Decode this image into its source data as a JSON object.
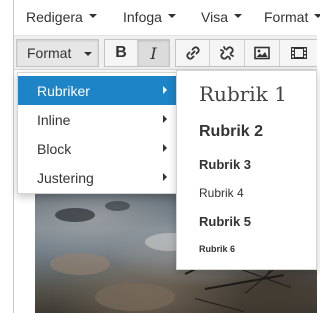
{
  "menubar": {
    "items": [
      {
        "label": "Redigera"
      },
      {
        "label": "Infoga"
      },
      {
        "label": "Visa"
      },
      {
        "label": "Format"
      }
    ]
  },
  "toolbar": {
    "format_label": "Format",
    "bold_label": "B",
    "italic_label": "I",
    "icons": [
      "link-icon",
      "unlink-icon",
      "image-icon",
      "media-icon"
    ]
  },
  "format_menu": {
    "items": [
      {
        "label": "Rubriker",
        "active": true
      },
      {
        "label": "Inline",
        "active": false
      },
      {
        "label": "Block",
        "active": false
      },
      {
        "label": "Justering",
        "active": false
      }
    ]
  },
  "headings_menu": {
    "items": [
      {
        "label": "Rubrik 1"
      },
      {
        "label": "Rubrik 2"
      },
      {
        "label": "Rubrik 3"
      },
      {
        "label": "Rubrik 4"
      },
      {
        "label": "Rubrik 5"
      },
      {
        "label": "Rubrik 6"
      }
    ]
  },
  "colors": {
    "accent": "#1d84c8",
    "text": "#333333",
    "toolbar_bg": "#f0f0f0"
  }
}
